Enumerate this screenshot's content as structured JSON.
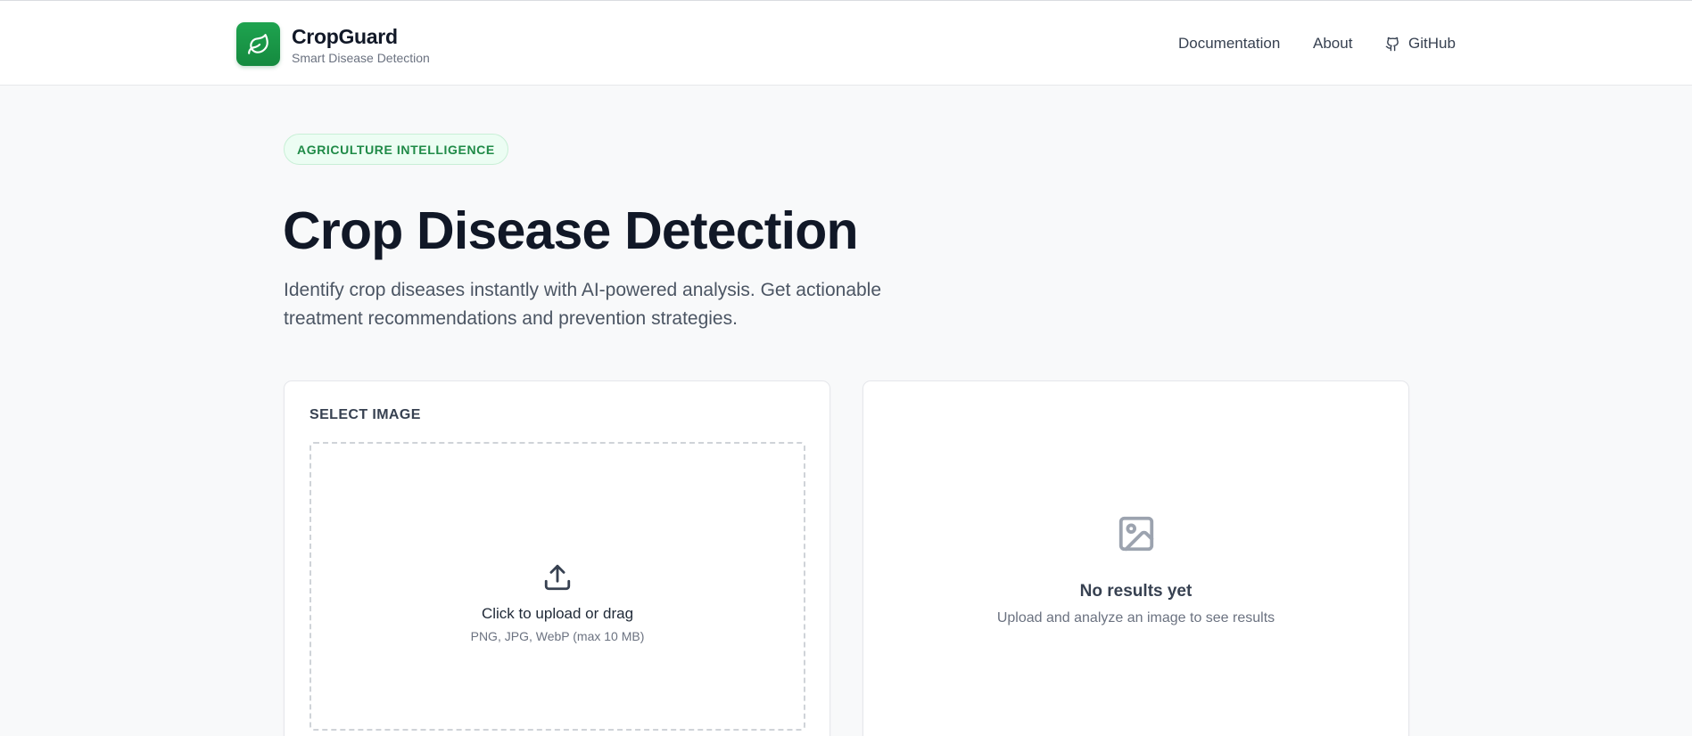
{
  "header": {
    "brand_name": "CropGuard",
    "brand_tagline": "Smart Disease Detection",
    "logo_icon": "leaf-icon",
    "nav": {
      "documentation": "Documentation",
      "about": "About",
      "github": "GitHub"
    }
  },
  "hero": {
    "badge": "AGRICULTURE INTELLIGENCE",
    "title": "Crop Disease Detection",
    "subtitle": "Identify crop diseases instantly with AI-powered analysis. Get actionable treatment recommendations and prevention strategies."
  },
  "upload_panel": {
    "label": "SELECT IMAGE",
    "icon": "upload-icon",
    "title": "Click to upload or drag",
    "hint": "PNG, JPG, WebP (max 10 MB)"
  },
  "results_panel": {
    "icon": "image-icon",
    "title": "No results yet",
    "subtitle": "Upload and analyze an image to see results"
  },
  "colors": {
    "brand_green": "#18974a",
    "badge_bg": "#ecfdf3",
    "badge_text": "#1f8a47",
    "page_bg": "#f8f9fa"
  }
}
